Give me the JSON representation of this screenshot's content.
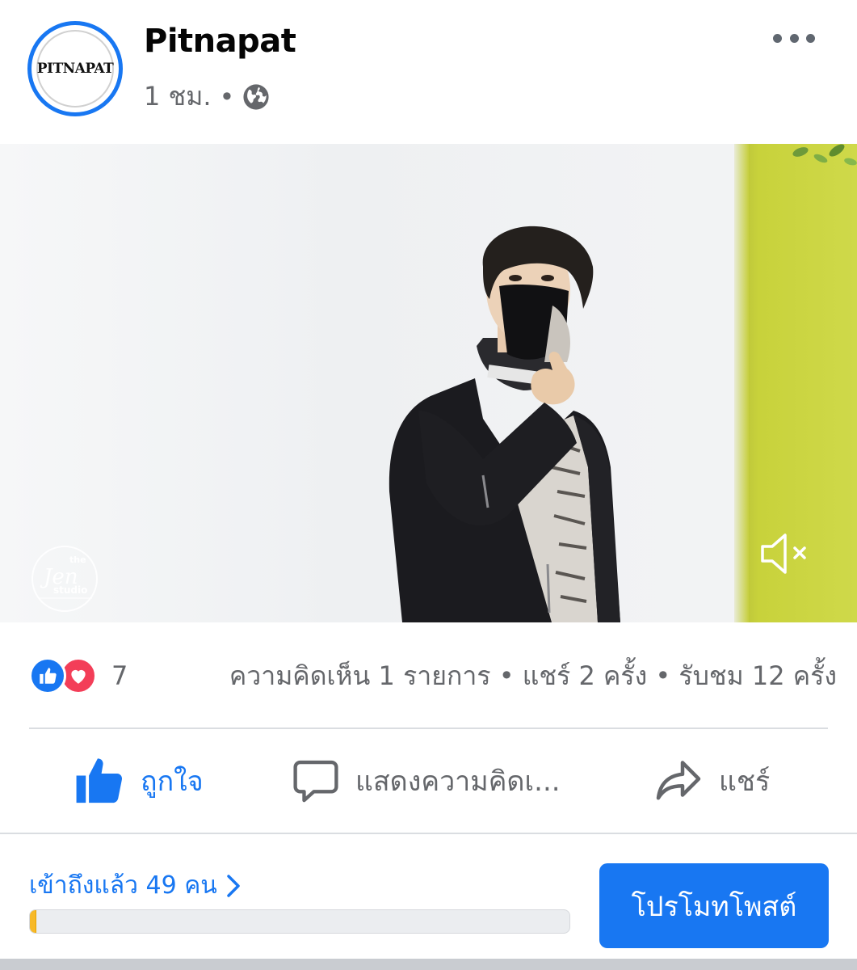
{
  "post": {
    "page_name": "Pitnapat",
    "avatar_text": "PITNAPAT",
    "time": "1 ชม.",
    "separator": "•",
    "privacy_icon": "globe-icon",
    "more_icon": "more-horizontal-icon"
  },
  "media": {
    "type": "video",
    "mute_icon": "volume-muted-icon",
    "watermark_logo": "the Jen studio"
  },
  "stats": {
    "reactions": [
      "like-icon",
      "love-icon"
    ],
    "reaction_count": "7",
    "summary": "ความคิดเห็น 1 รายการ • แชร์ 2 ครั้ง • รับชม 12 ครั้ง"
  },
  "actions": {
    "like_label": "ถูกใจ",
    "comment_label": "แสดงความคิดเ...",
    "share_label": "แชร์"
  },
  "boost": {
    "reach_text": "เข้าถึงแล้ว 49 คน",
    "progress_fraction": 0.012,
    "promote_label": "โปรโมทโพสต์"
  },
  "colors": {
    "accent": "#1877f2",
    "love": "#f33e58",
    "secondary_text": "#65676b",
    "progress": "#f7b928"
  }
}
